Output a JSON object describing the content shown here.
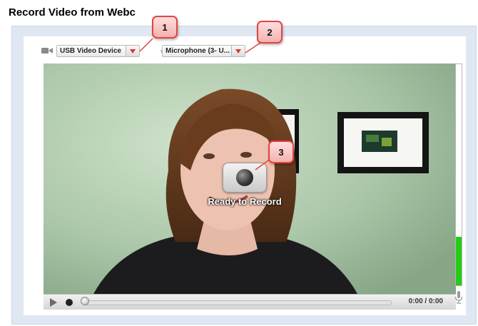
{
  "page": {
    "title": "Record Video from Webc"
  },
  "toolbar": {
    "camera_icon": "video-camera-icon",
    "camera_select": {
      "selected": "USB Video Device"
    },
    "microphone_icon": "microphone-icon",
    "microphone_select": {
      "selected": "Microphone (3- U..."
    }
  },
  "video": {
    "record_button_icon": "record-icon",
    "status_text": "Ready to Record"
  },
  "controls": {
    "play_icon": "play-icon",
    "record_icon": "record-icon",
    "time": "0:00 / 0:00",
    "seek_progress": 0.0
  },
  "audio_meter": {
    "level": 0.22,
    "icon": "microphone-icon"
  },
  "callouts": [
    {
      "label": "1"
    },
    {
      "label": "2"
    },
    {
      "label": "3"
    }
  ],
  "colors": {
    "callout_border": "#e2453f",
    "callout_fill": "#f3b1b1",
    "meter_green": "#24cc18",
    "arrow_red": "#d23a3a"
  }
}
